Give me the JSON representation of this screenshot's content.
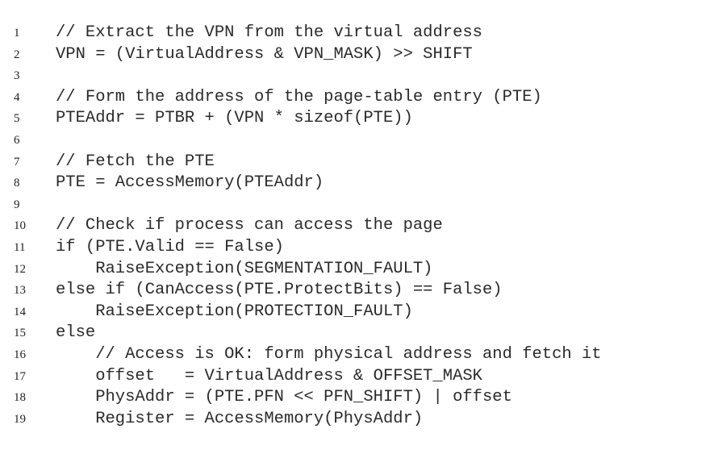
{
  "lines": [
    {
      "n": "1",
      "text": "// Extract the VPN from the virtual address"
    },
    {
      "n": "2",
      "text": "VPN = (VirtualAddress & VPN_MASK) >> SHIFT"
    },
    {
      "n": "3",
      "text": ""
    },
    {
      "n": "4",
      "text": "// Form the address of the page-table entry (PTE)"
    },
    {
      "n": "5",
      "text": "PTEAddr = PTBR + (VPN * sizeof(PTE))"
    },
    {
      "n": "6",
      "text": ""
    },
    {
      "n": "7",
      "text": "// Fetch the PTE"
    },
    {
      "n": "8",
      "text": "PTE = AccessMemory(PTEAddr)"
    },
    {
      "n": "9",
      "text": ""
    },
    {
      "n": "10",
      "text": "// Check if process can access the page"
    },
    {
      "n": "11",
      "text": "if (PTE.Valid == False)"
    },
    {
      "n": "12",
      "text": "    RaiseException(SEGMENTATION_FAULT)"
    },
    {
      "n": "13",
      "text": "else if (CanAccess(PTE.ProtectBits) == False)"
    },
    {
      "n": "14",
      "text": "    RaiseException(PROTECTION_FAULT)"
    },
    {
      "n": "15",
      "text": "else"
    },
    {
      "n": "16",
      "text": "    // Access is OK: form physical address and fetch it"
    },
    {
      "n": "17",
      "text": "    offset   = VirtualAddress & OFFSET_MASK"
    },
    {
      "n": "18",
      "text": "    PhysAddr = (PTE.PFN << PFN_SHIFT) | offset"
    },
    {
      "n": "19",
      "text": "    Register = AccessMemory(PhysAddr)"
    }
  ]
}
